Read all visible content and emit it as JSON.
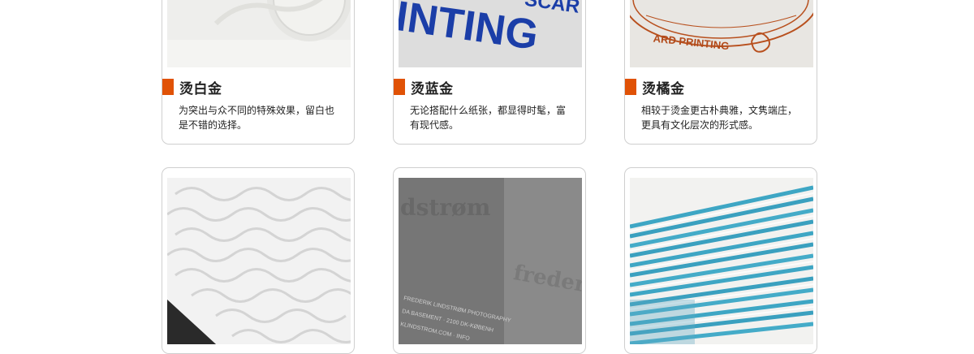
{
  "cards": [
    {
      "title": "烫白金",
      "description": "为突出与众不同的特殊效果，留白也是不错的选择。",
      "image_icon": "white-foil-photo"
    },
    {
      "title": "烫蓝金",
      "description": "无论搭配什么纸张，都显得时髦，富有现代感。",
      "image_icon": "blue-foil-photo",
      "image_text": "INTING",
      "image_text_top": "SCAR"
    },
    {
      "title": "烫橘金",
      "description": "相较于烫金更古朴典雅，文隽端庄，更具有文化层次的形式感。",
      "image_icon": "orange-foil-photo",
      "image_text": "ARD PRINTING"
    },
    {
      "image_icon": "embossed-wave-photo"
    },
    {
      "image_icon": "gray-emboss-card-photo",
      "image_text": "dstrøm",
      "image_text_side": "frederi",
      "image_lines": [
        "FREDERIK LINDSTRØM PHOTOGRAPHY",
        "DA BASEMENT · 2100 DK-KØBENH",
        "KLINDSTROM.COM · INFO"
      ]
    },
    {
      "image_icon": "blue-edge-cards-photo"
    }
  ],
  "colors": {
    "accent": "#e05206",
    "border": "#cfcfcf"
  }
}
